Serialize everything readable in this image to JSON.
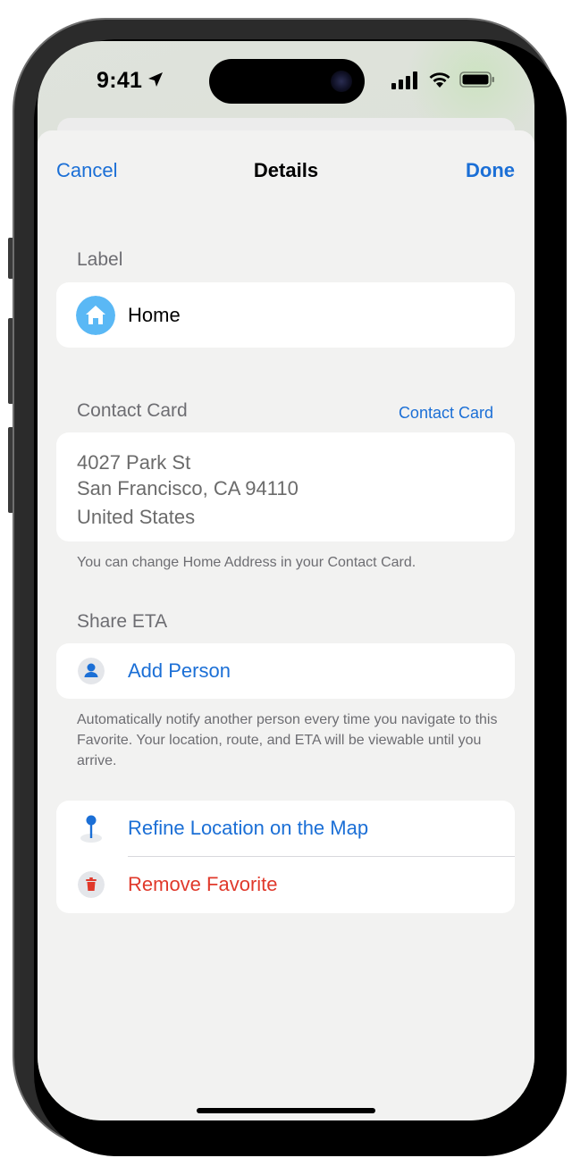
{
  "status_bar": {
    "time": "9:41"
  },
  "nav": {
    "cancel": "Cancel",
    "title": "Details",
    "done": "Done"
  },
  "label_section": {
    "header": "Label",
    "value": "Home",
    "icon": "house-icon"
  },
  "contact_section": {
    "header": "Contact Card",
    "link": "Contact Card",
    "address_lines": [
      "4027 Park St",
      "San Francisco, CA 94110",
      "United States"
    ],
    "footnote": "You can change Home Address in your Contact Card."
  },
  "eta_section": {
    "header": "Share ETA",
    "add_person": "Add Person",
    "footnote": "Automatically notify another person every time you navigate to this Favorite. Your location, route, and ETA will be viewable until you arrive."
  },
  "actions": {
    "refine": "Refine Location on the Map",
    "remove": "Remove Favorite"
  },
  "colors": {
    "accent": "#1b6fd6",
    "destructive": "#e0392b",
    "home_icon": "#5ab8f5"
  }
}
